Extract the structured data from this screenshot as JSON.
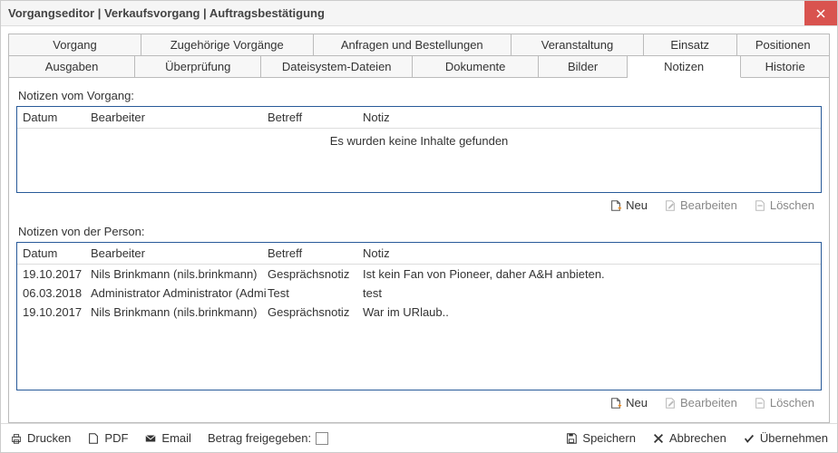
{
  "title": "Vorgangseditor | Verkaufsvorgang | Auftragsbestätigung",
  "tabs_row1": [
    "Vorgang",
    "Zugehörige Vorgänge",
    "Anfragen und Bestellungen",
    "Veranstaltung",
    "Einsatz",
    "Positionen"
  ],
  "tabs_row2": [
    "Ausgaben",
    "Überprüfung",
    "Dateisystem-Dateien",
    "Dokumente",
    "Bilder",
    "Notizen",
    "Historie"
  ],
  "section1": {
    "label": "Notizen vom Vorgang:",
    "columns": {
      "datum": "Datum",
      "bearbeiter": "Bearbeiter",
      "betreff": "Betreff",
      "notiz": "Notiz"
    },
    "empty": "Es wurden keine Inhalte gefunden"
  },
  "section2": {
    "label": "Notizen von der Person:",
    "columns": {
      "datum": "Datum",
      "bearbeiter": "Bearbeiter",
      "betreff": "Betreff",
      "notiz": "Notiz"
    },
    "rows": [
      {
        "datum": "19.10.2017",
        "bearbeiter": "Nils Brinkmann (nils.brinkmann)",
        "betreff": "Gesprächsnotiz",
        "notiz": "Ist kein Fan von Pioneer, daher A&H anbieten."
      },
      {
        "datum": "06.03.2018",
        "bearbeiter": "Administrator Administrator (Admi",
        "betreff": "Test",
        "notiz": "test"
      },
      {
        "datum": "19.10.2017",
        "bearbeiter": "Nils Brinkmann (nils.brinkmann)",
        "betreff": "Gesprächsnotiz",
        "notiz": "War im URlaub.."
      }
    ]
  },
  "actions": {
    "neu": "Neu",
    "bearbeiten": "Bearbeiten",
    "loeschen": "Löschen"
  },
  "footer": {
    "drucken": "Drucken",
    "pdf": "PDF",
    "email": "Email",
    "freigeben": "Betrag freigegeben:",
    "speichern": "Speichern",
    "abbrechen": "Abbrechen",
    "uebernehmen": "Übernehmen"
  }
}
